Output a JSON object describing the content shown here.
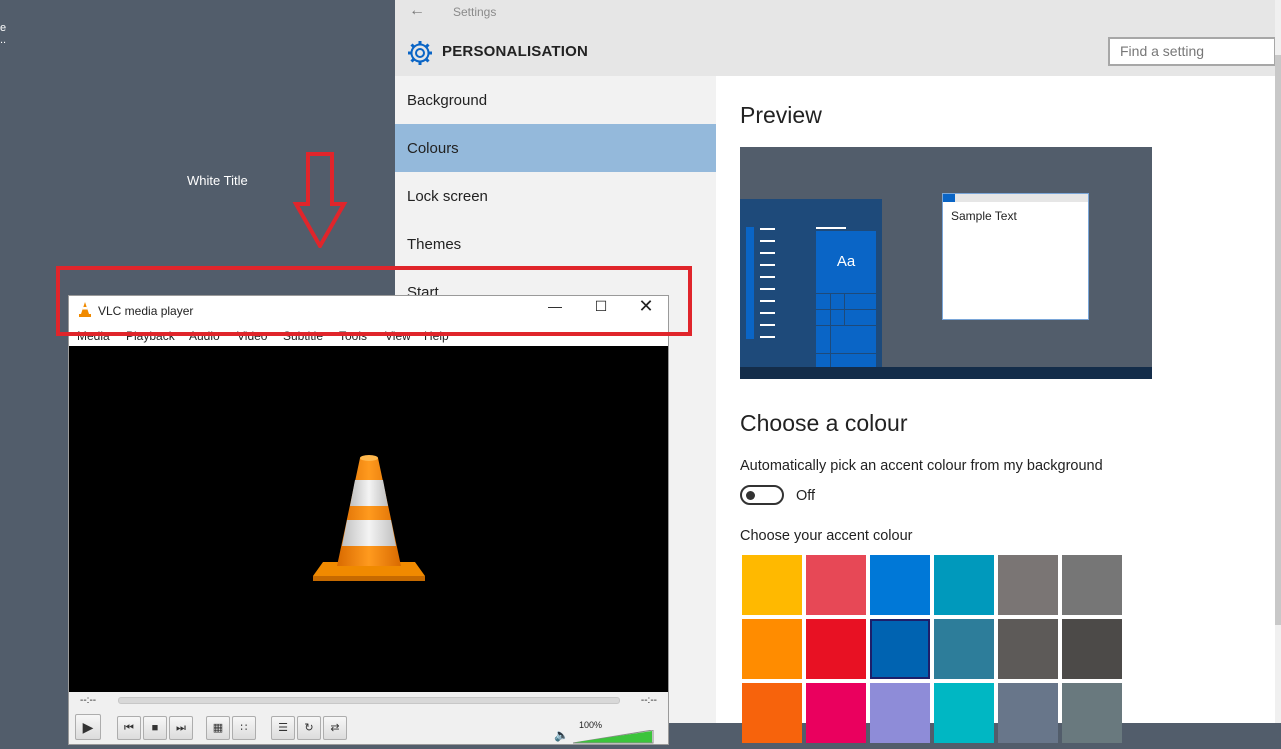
{
  "desktop": {
    "fragments": [
      "e",
      ".."
    ],
    "annotation_label": "White Title"
  },
  "settings": {
    "window_title": "Settings",
    "header_title": "PERSONALISATION",
    "search_placeholder": "Find a setting",
    "nav_items": [
      "Background",
      "Colours",
      "Lock screen",
      "Themes",
      "Start"
    ],
    "selected_nav": "Colours",
    "preview_heading": "Preview",
    "preview_sample_text": "Sample Text",
    "preview_tile_text": "Aa",
    "choose_heading": "Choose a colour",
    "auto_accent_text": "Automatically pick an accent colour from my background",
    "toggle_state": "Off",
    "accent_label": "Choose your accent colour",
    "accent_colors": [
      [
        "#ffb900",
        "#e74856",
        "#0078d7",
        "#0099bc",
        "#7a7574",
        "#767676"
      ],
      [
        "#ff8c00",
        "#e81123",
        "#0063b1",
        "#2d7d9a",
        "#5d5a58",
        "#4c4a48"
      ],
      [
        "#f7630c",
        "#ea005e",
        "#8e8cd8",
        "#00b7c3",
        "#68768a",
        "#69797e"
      ]
    ],
    "selected_accent": "#0063b1"
  },
  "vlc": {
    "title": "VLC media player",
    "menu": [
      "Media",
      "Playback",
      "Audio",
      "Video",
      "Subtitle",
      "Tools",
      "View",
      "Help"
    ],
    "time_elapsed": "--:--",
    "time_total": "--:--",
    "volume": "100%",
    "volume_level": 1.0
  },
  "colors": {
    "annotation_red": "#e0252b",
    "accent_blue": "#0a65c6",
    "selected_nav_bg": "#94b9db"
  }
}
